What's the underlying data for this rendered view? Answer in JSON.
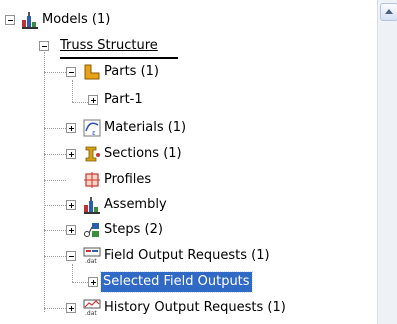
{
  "tree": {
    "nodes": [
      {
        "label": "Models (1)",
        "icon": "models-icon",
        "expanded": true
      },
      {
        "label": "Truss Structure",
        "icon": "",
        "expanded": true
      },
      {
        "label": "Parts (1)",
        "icon": "parts-icon",
        "expanded": true
      },
      {
        "label": "Part-1",
        "icon": "",
        "expanded": false
      },
      {
        "label": "Materials (1)",
        "icon": "materials-icon",
        "expanded": false
      },
      {
        "label": "Sections (1)",
        "icon": "sections-icon",
        "expanded": false
      },
      {
        "label": "Profiles",
        "icon": "profiles-icon",
        "expanded": false
      },
      {
        "label": "Assembly",
        "icon": "assembly-icon",
        "expanded": false
      },
      {
        "label": "Steps (2)",
        "icon": "steps-icon",
        "expanded": false
      },
      {
        "label": "Field Output Requests (1)",
        "icon": "field-output-icon",
        "expanded": true
      },
      {
        "label": "Selected Field Outputs",
        "icon": "",
        "expanded": false,
        "selected": true
      },
      {
        "label": "History Output Requests (1)",
        "icon": "history-output-icon",
        "expanded": false
      }
    ]
  },
  "colors": {
    "selection": "#316ac5",
    "selection_text": "#ffffff"
  }
}
